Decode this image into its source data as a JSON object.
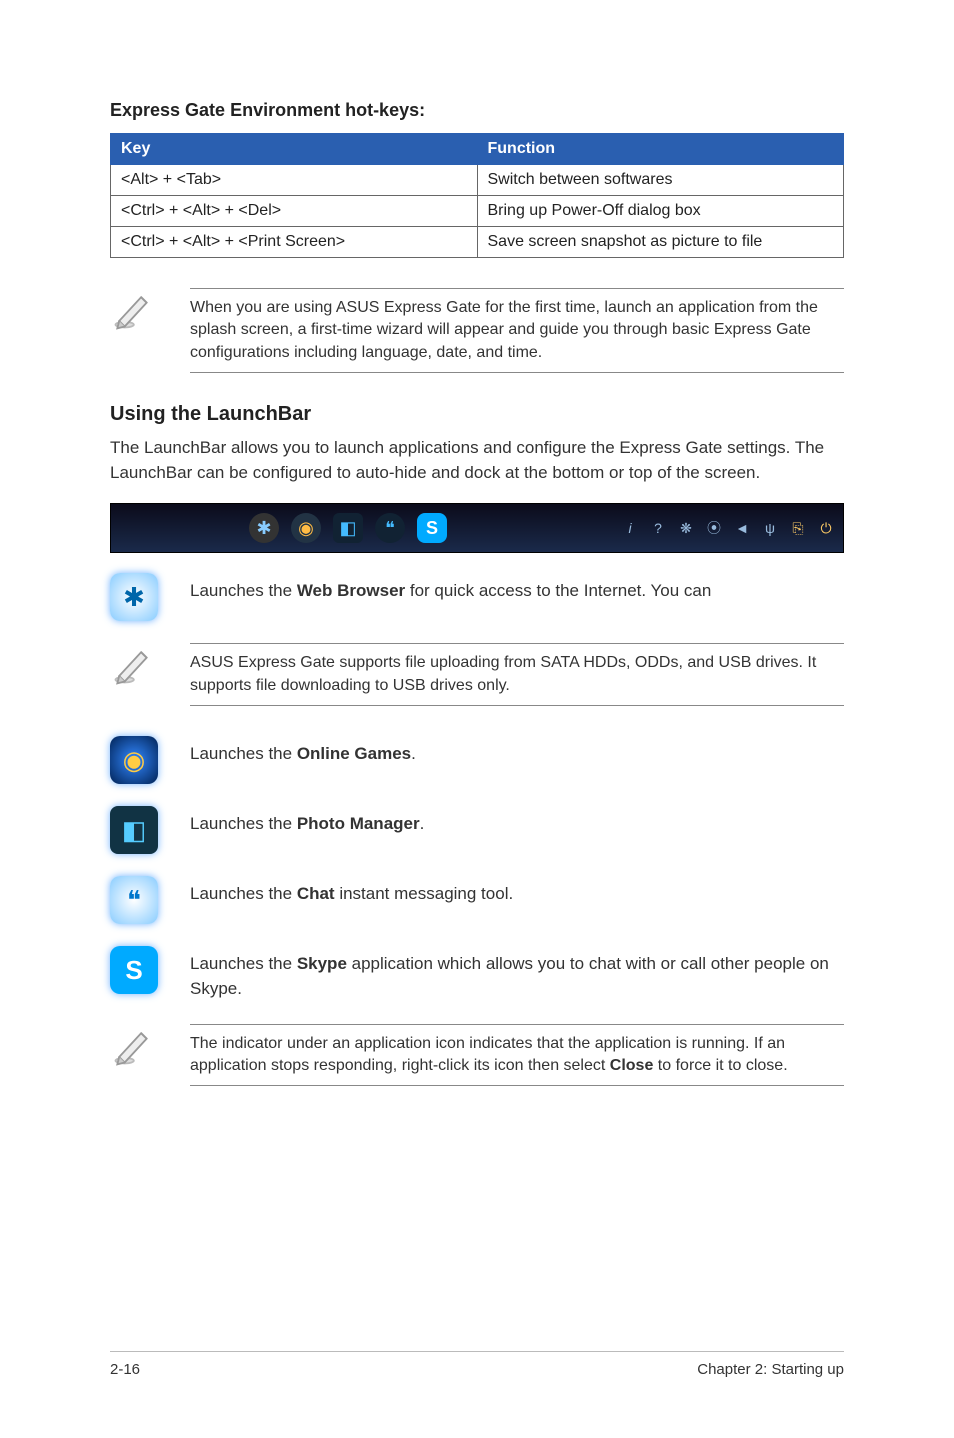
{
  "hotkeys": {
    "heading": "Express Gate Environment hot-keys:",
    "header_key": "Key",
    "header_fn": "Function",
    "rows": [
      {
        "k": "<Alt> + <Tab>",
        "f": "Switch between softwares"
      },
      {
        "k": "<Ctrl> + <Alt> + <Del>",
        "f": "Bring up Power-Off dialog box"
      },
      {
        "k": "<Ctrl> + <Alt> + <Print Screen>",
        "f": "Save screen snapshot as picture to file"
      }
    ]
  },
  "note1": "When you are using ASUS Express Gate for the first time, launch an application from the splash screen, a first-time wizard will appear and guide you through basic Express Gate configurations including language, date, and time.",
  "launchbar": {
    "heading": "Using the LaunchBar",
    "body": "The LaunchBar allows you to launch applications and configure the Express Gate settings. The LaunchBar can be configured to auto-hide and dock at the bottom or top of the screen."
  },
  "items": {
    "web_pre": "Launches the ",
    "web_strong": "Web Browser",
    "web_post": " for quick access to the Internet. You can",
    "note2": "ASUS Express Gate supports file uploading from SATA HDDs, ODDs, and USB drives. It supports file downloading to USB drives only.",
    "games_pre": "Launches the ",
    "games_strong": "Online Games",
    "games_post": ".",
    "photo_pre": "Launches the ",
    "photo_strong": "Photo Manager",
    "photo_post": ".",
    "chat_pre": "Launches the ",
    "chat_strong": "Chat",
    "chat_post": " instant messaging tool.",
    "skype_pre": "Launches the ",
    "skype_strong": "Skype",
    "skype_post": " application which allows you to chat with or call other people on Skype."
  },
  "note3_pre": "The indicator under an application icon indicates that the application is running. If an application stops responding, right-click its icon then select ",
  "note3_strong": "Close",
  "note3_post": " to force it to close.",
  "footer": {
    "left": "2-16",
    "right": "Chapter 2: Starting up"
  }
}
